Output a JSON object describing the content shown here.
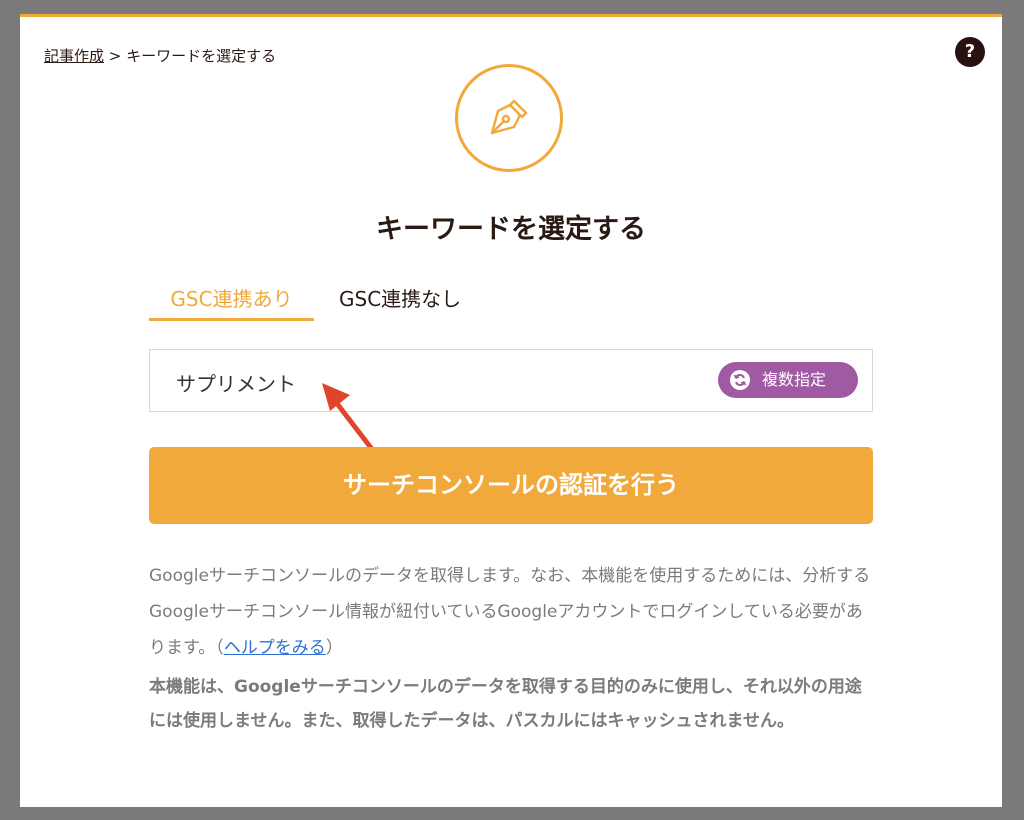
{
  "breadcrumb": {
    "link": "記事作成",
    "separator": " > ",
    "current": "キーワードを選定する"
  },
  "help_button": "?",
  "title": "キーワードを選定する",
  "tabs": [
    {
      "label": "GSC連携あり",
      "active": true
    },
    {
      "label": "GSC連携なし",
      "active": false
    }
  ],
  "keyword_input": {
    "value": "サプリメント",
    "placeholder": ""
  },
  "multi_button": {
    "label": "複数指定"
  },
  "auth_button": {
    "label": "サーチコンソールの認証を行う"
  },
  "description": {
    "text": "Googleサーチコンソールのデータを取得します。なお、本機能を使用するためには、分析するGoogleサーチコンソール情報が紐付いているGoogleアカウントでログインしている必要があります。（",
    "link": "ヘルプをみる",
    "close": "）"
  },
  "note": "本機能は、Googleサーチコンソールのデータを取得する目的のみに使用し、それ以外の用途には使用しません。また、取得したデータは、パスカルにはキャッシュされません。",
  "colors": {
    "accent": "#f2a93b",
    "multi_button": "#a05aa4",
    "link": "#2e6fd8",
    "arrow": "#e0442a"
  },
  "icons": {
    "hero": "pen-nib-icon",
    "multi": "cycle-icon",
    "help": "question-icon"
  }
}
